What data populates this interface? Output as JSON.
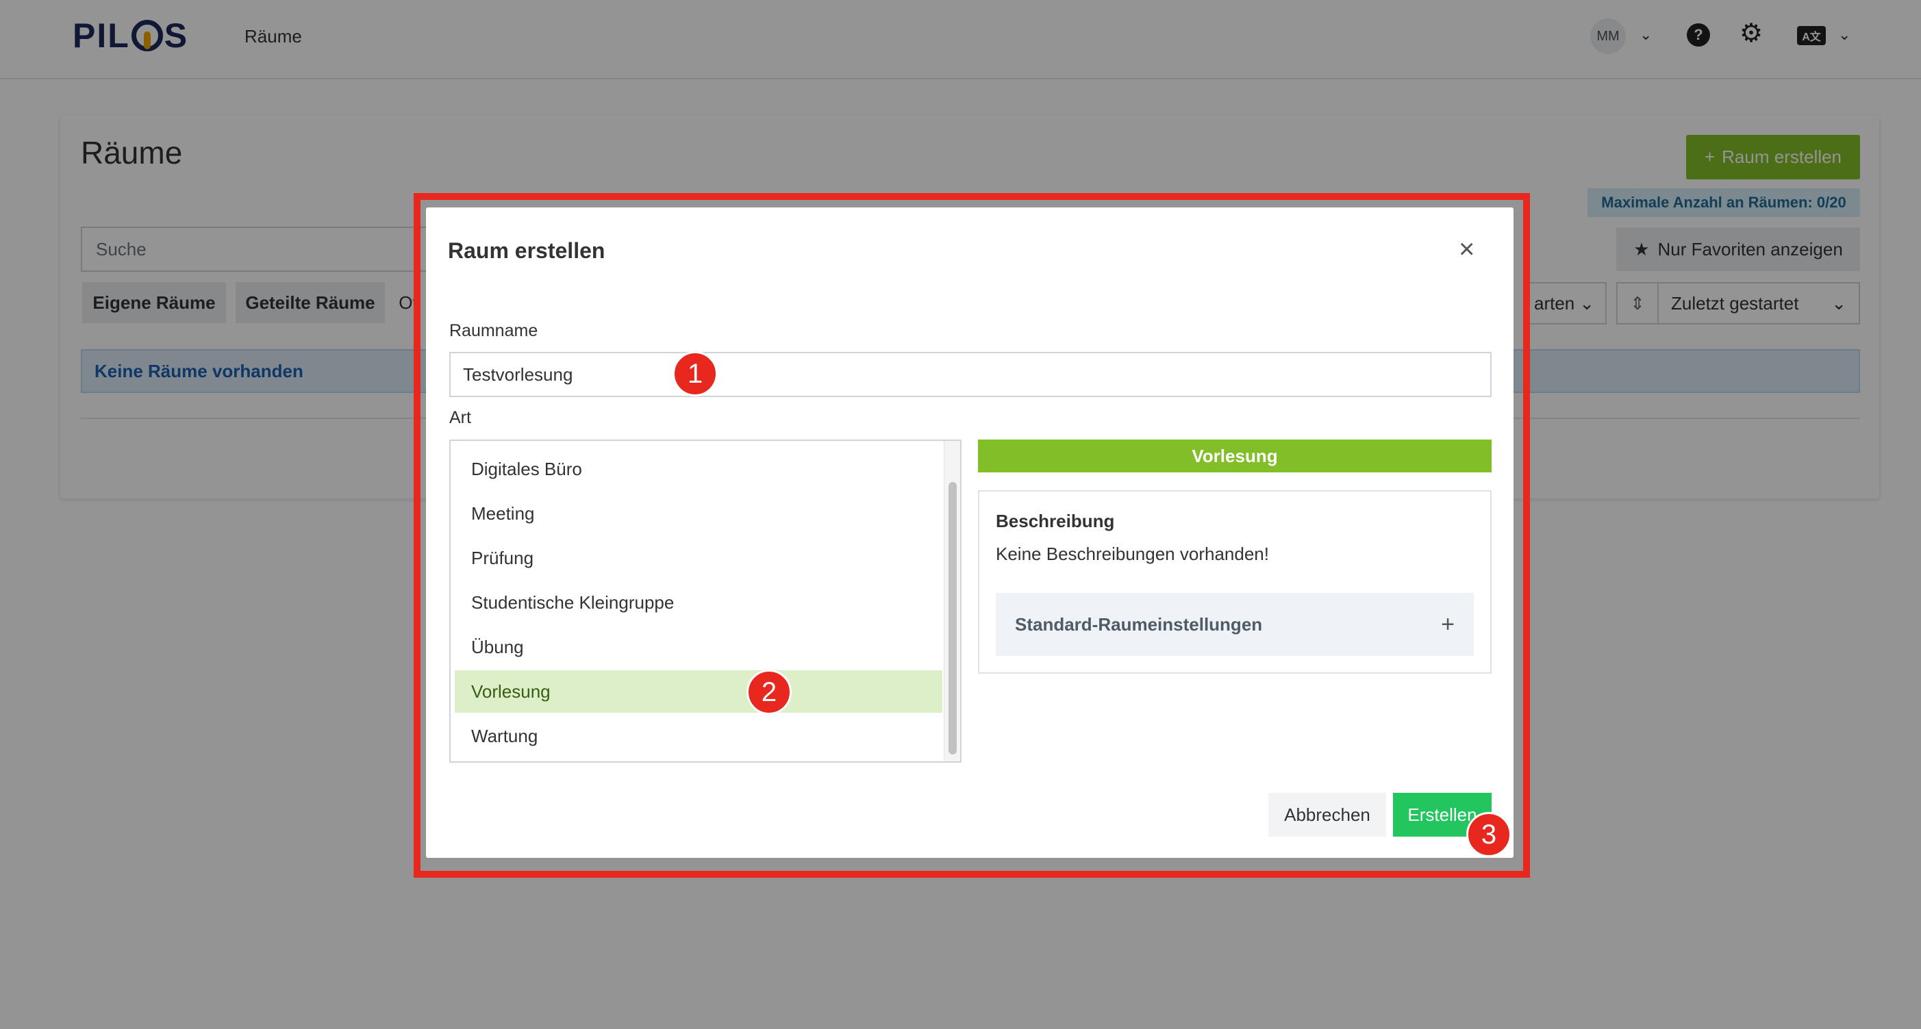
{
  "header": {
    "logo": "PILOS",
    "nav_rooms": "Räume",
    "avatar_initials": "MM",
    "help_glyph": "?",
    "lang_glyph": "A文"
  },
  "page": {
    "title": "Räume",
    "create_room_label": "Raum erstellen",
    "max_rooms": "Maximale Anzahl an Räumen: 0/20",
    "search_placeholder": "Suche",
    "favorites_label": "Nur Favoriten anzeigen",
    "filters": [
      "Eigene Räume",
      "Geteilte Räume",
      "Of"
    ],
    "room_type_filter": "arten",
    "sort_label": "Zuletzt gestartet",
    "empty_message": "Keine Räume vorhanden"
  },
  "modal": {
    "title": "Raum erstellen",
    "name_label": "Raumname",
    "name_value": "Testvorlesung",
    "type_label": "Art",
    "room_types": [
      "Digitales Büro",
      "Meeting",
      "Prüfung",
      "Studentische Kleingruppe",
      "Übung",
      "Vorlesung",
      "Wartung"
    ],
    "selected_type": "Vorlesung",
    "description_title": "Beschreibung",
    "description_text": "Keine Beschreibungen vorhanden!",
    "default_settings_label": "Standard-Raumeinstellungen",
    "cancel_label": "Abbrechen",
    "submit_label": "Erstellen"
  },
  "callouts": [
    "1",
    "2",
    "3"
  ],
  "colors": {
    "accent_green": "#82be28",
    "submit_green": "#22c55e",
    "highlight_red": "#e8281e"
  }
}
